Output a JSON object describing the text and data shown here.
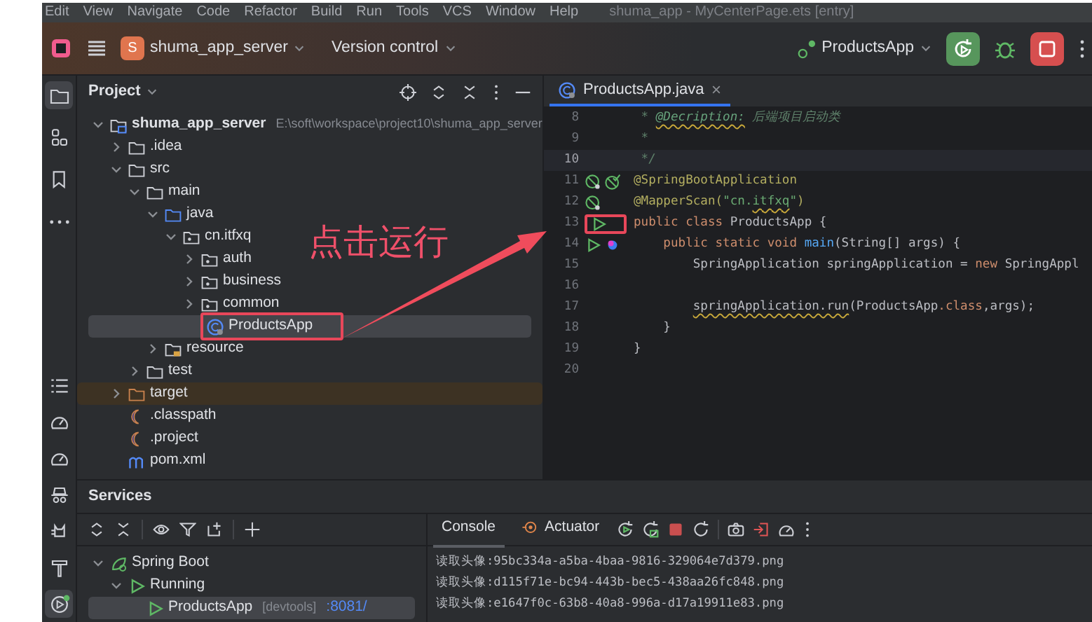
{
  "menu_bar": {
    "items": [
      "Edit",
      "View",
      "Navigate",
      "Code",
      "Refactor",
      "Build",
      "Run",
      "Tools",
      "VCS",
      "Window",
      "Help"
    ],
    "title": "shuma_app - MyCenterPage.ets [entry]"
  },
  "title_bar": {
    "project_initial": "S",
    "project": "shuma_app_server",
    "vcs": "Version control",
    "run_config": "ProductsApp"
  },
  "tool_strip": {
    "top": [
      {
        "kind": "folder",
        "selected": true
      },
      {
        "kind": "structure",
        "selected": false
      },
      {
        "kind": "bookmark",
        "selected": false
      },
      {
        "kind": "more",
        "selected": false
      }
    ],
    "bottom": [
      {
        "kind": "list",
        "selected": false
      },
      {
        "kind": "gauge",
        "selected": false
      },
      {
        "kind": "gauge",
        "selected": false
      },
      {
        "kind": "robot",
        "selected": false
      },
      {
        "kind": "cat",
        "selected": false
      },
      {
        "kind": "hammer",
        "selected": false
      },
      {
        "kind": "services",
        "selected": true
      }
    ]
  },
  "project_panel": {
    "title": "Project",
    "tree": [
      {
        "label": "shuma_app_server",
        "kind": "module",
        "hint": "E:\\soft\\workspace\\project10\\shuma_app_server",
        "expanded": true,
        "selected": false,
        "children": [
          {
            "label": ".idea",
            "kind": "folder",
            "expanded": false,
            "selected": false
          },
          {
            "label": "src",
            "kind": "folder",
            "expanded": true,
            "selected": false,
            "children": [
              {
                "label": "main",
                "kind": "folder",
                "expanded": true,
                "selected": false,
                "children": [
                  {
                    "label": "java",
                    "kind": "source-root",
                    "expanded": true,
                    "selected": false,
                    "children": [
                      {
                        "label": "cn.itfxq",
                        "kind": "package",
                        "expanded": true,
                        "selected": false,
                        "children": [
                          {
                            "label": "auth",
                            "kind": "package",
                            "expanded": false,
                            "selected": false
                          },
                          {
                            "label": "business",
                            "kind": "package",
                            "expanded": false,
                            "selected": false
                          },
                          {
                            "label": "common",
                            "kind": "package",
                            "expanded": false,
                            "selected": false
                          },
                          {
                            "label": "ProductsApp",
                            "kind": "class",
                            "selected": true,
                            "callout": true
                          }
                        ]
                      }
                    ]
                  },
                  {
                    "label": "resource",
                    "kind": "resource-folder",
                    "expanded": false,
                    "selected": false
                  }
                ]
              },
              {
                "label": "test",
                "kind": "folder",
                "expanded": false,
                "selected": false
              }
            ]
          },
          {
            "label": "target",
            "kind": "excluded-folder",
            "expanded": false,
            "selected": false
          },
          {
            "label": ".classpath",
            "kind": "eclipse-file",
            "selected": false
          },
          {
            "label": ".project",
            "kind": "eclipse-file",
            "selected": false
          },
          {
            "label": "pom.xml",
            "kind": "maven",
            "selected": false
          }
        ]
      }
    ]
  },
  "editor": {
    "tabs": [
      {
        "label": "ProductsApp.java",
        "selected": true
      }
    ],
    "lines": [
      {
        "number": "8",
        "current": false,
        "tokens": [
          {
            "t": " * ",
            "kind": "comment"
          },
          {
            "t": "@Decription:",
            "kind": "doctag",
            "squiggle": true
          },
          {
            "t": " 后端项目启动类",
            "kind": "comment"
          }
        ]
      },
      {
        "number": "9",
        "current": false,
        "tokens": [
          {
            "t": " *",
            "kind": "comment"
          }
        ]
      },
      {
        "number": "10",
        "current": true,
        "tokens": [
          {
            "t": " */",
            "kind": "comment"
          }
        ]
      },
      {
        "number": "11",
        "current": false,
        "gutter": [
          {
            "kind": "bean",
            "callout": false
          },
          {
            "kind": "bean-check",
            "callout": false
          }
        ],
        "tokens": [
          {
            "t": "@SpringBootApplication",
            "kind": "annotation"
          }
        ]
      },
      {
        "number": "12",
        "current": false,
        "gutter": [
          {
            "kind": "bean",
            "callout": false
          }
        ],
        "tokens": [
          {
            "t": "@MapperScan(",
            "kind": "annotation"
          },
          {
            "t": "\"cn.",
            "kind": "string"
          },
          {
            "t": "itfxq",
            "kind": "string",
            "squiggle": true
          },
          {
            "t": "\"",
            "kind": "string"
          },
          {
            "t": ")",
            "kind": "annotation"
          }
        ]
      },
      {
        "number": "13",
        "current": false,
        "gutter": [
          {
            "kind": "run",
            "callout": true
          }
        ],
        "tokens": [
          {
            "t": "public class ",
            "kind": "keyword"
          },
          {
            "t": "ProductsApp {",
            "kind": "plain"
          }
        ]
      },
      {
        "number": "14",
        "current": false,
        "gutter": [
          {
            "kind": "run",
            "callout": false
          },
          {
            "kind": "debug-dot",
            "callout": false
          }
        ],
        "tokens": [
          {
            "t": "    public static void ",
            "kind": "keyword"
          },
          {
            "t": "main",
            "kind": "method"
          },
          {
            "t": "(String[] args) {",
            "kind": "plain"
          }
        ]
      },
      {
        "number": "15",
        "current": false,
        "tokens": [
          {
            "t": "        SpringApplication springApplication = ",
            "kind": "plain"
          },
          {
            "t": "new ",
            "kind": "keyword"
          },
          {
            "t": "SpringAppl",
            "kind": "plain"
          }
        ]
      },
      {
        "number": "16",
        "current": false
      },
      {
        "number": "17",
        "current": false,
        "tokens": [
          {
            "t": "        springApplication.run",
            "kind": "plain",
            "squiggle": true
          },
          {
            "t": "(ProductsApp",
            "kind": "plain"
          },
          {
            "t": ".class",
            "kind": "keyword"
          },
          {
            "t": ",args);",
            "kind": "plain"
          }
        ]
      },
      {
        "number": "18",
        "current": false,
        "tokens": [
          {
            "t": "    }",
            "kind": "plain"
          }
        ]
      },
      {
        "number": "19",
        "current": false,
        "tokens": [
          {
            "t": "}",
            "kind": "plain"
          }
        ]
      },
      {
        "number": "20",
        "current": false
      }
    ]
  },
  "annotation": {
    "text": "点击运行"
  },
  "services": {
    "title": "Services",
    "tree": [
      {
        "label": "Spring Boot",
        "kind": "spring",
        "expanded": true,
        "selected": false,
        "children": [
          {
            "label": "Running",
            "kind": "run",
            "expanded": true,
            "selected": false,
            "children": [
              {
                "label": "ProductsApp",
                "kind": "app",
                "selected": true,
                "hint": "[devtools]",
                "port": ":8081/"
              }
            ]
          }
        ]
      }
    ],
    "tabs": [
      {
        "label": "Console",
        "kind": "console",
        "selected": true
      },
      {
        "label": "Actuator",
        "kind": "actuator",
        "selected": false
      }
    ],
    "console_lines": [
      "读取头像:95bc334a-a5ba-4baa-9816-329064e7d379.png",
      "读取头像:d115f71e-bc94-443b-bec5-438aa26fc848.png",
      "读取头像:e1647f0c-63b8-40a8-996a-d17a19911e83.png"
    ]
  }
}
